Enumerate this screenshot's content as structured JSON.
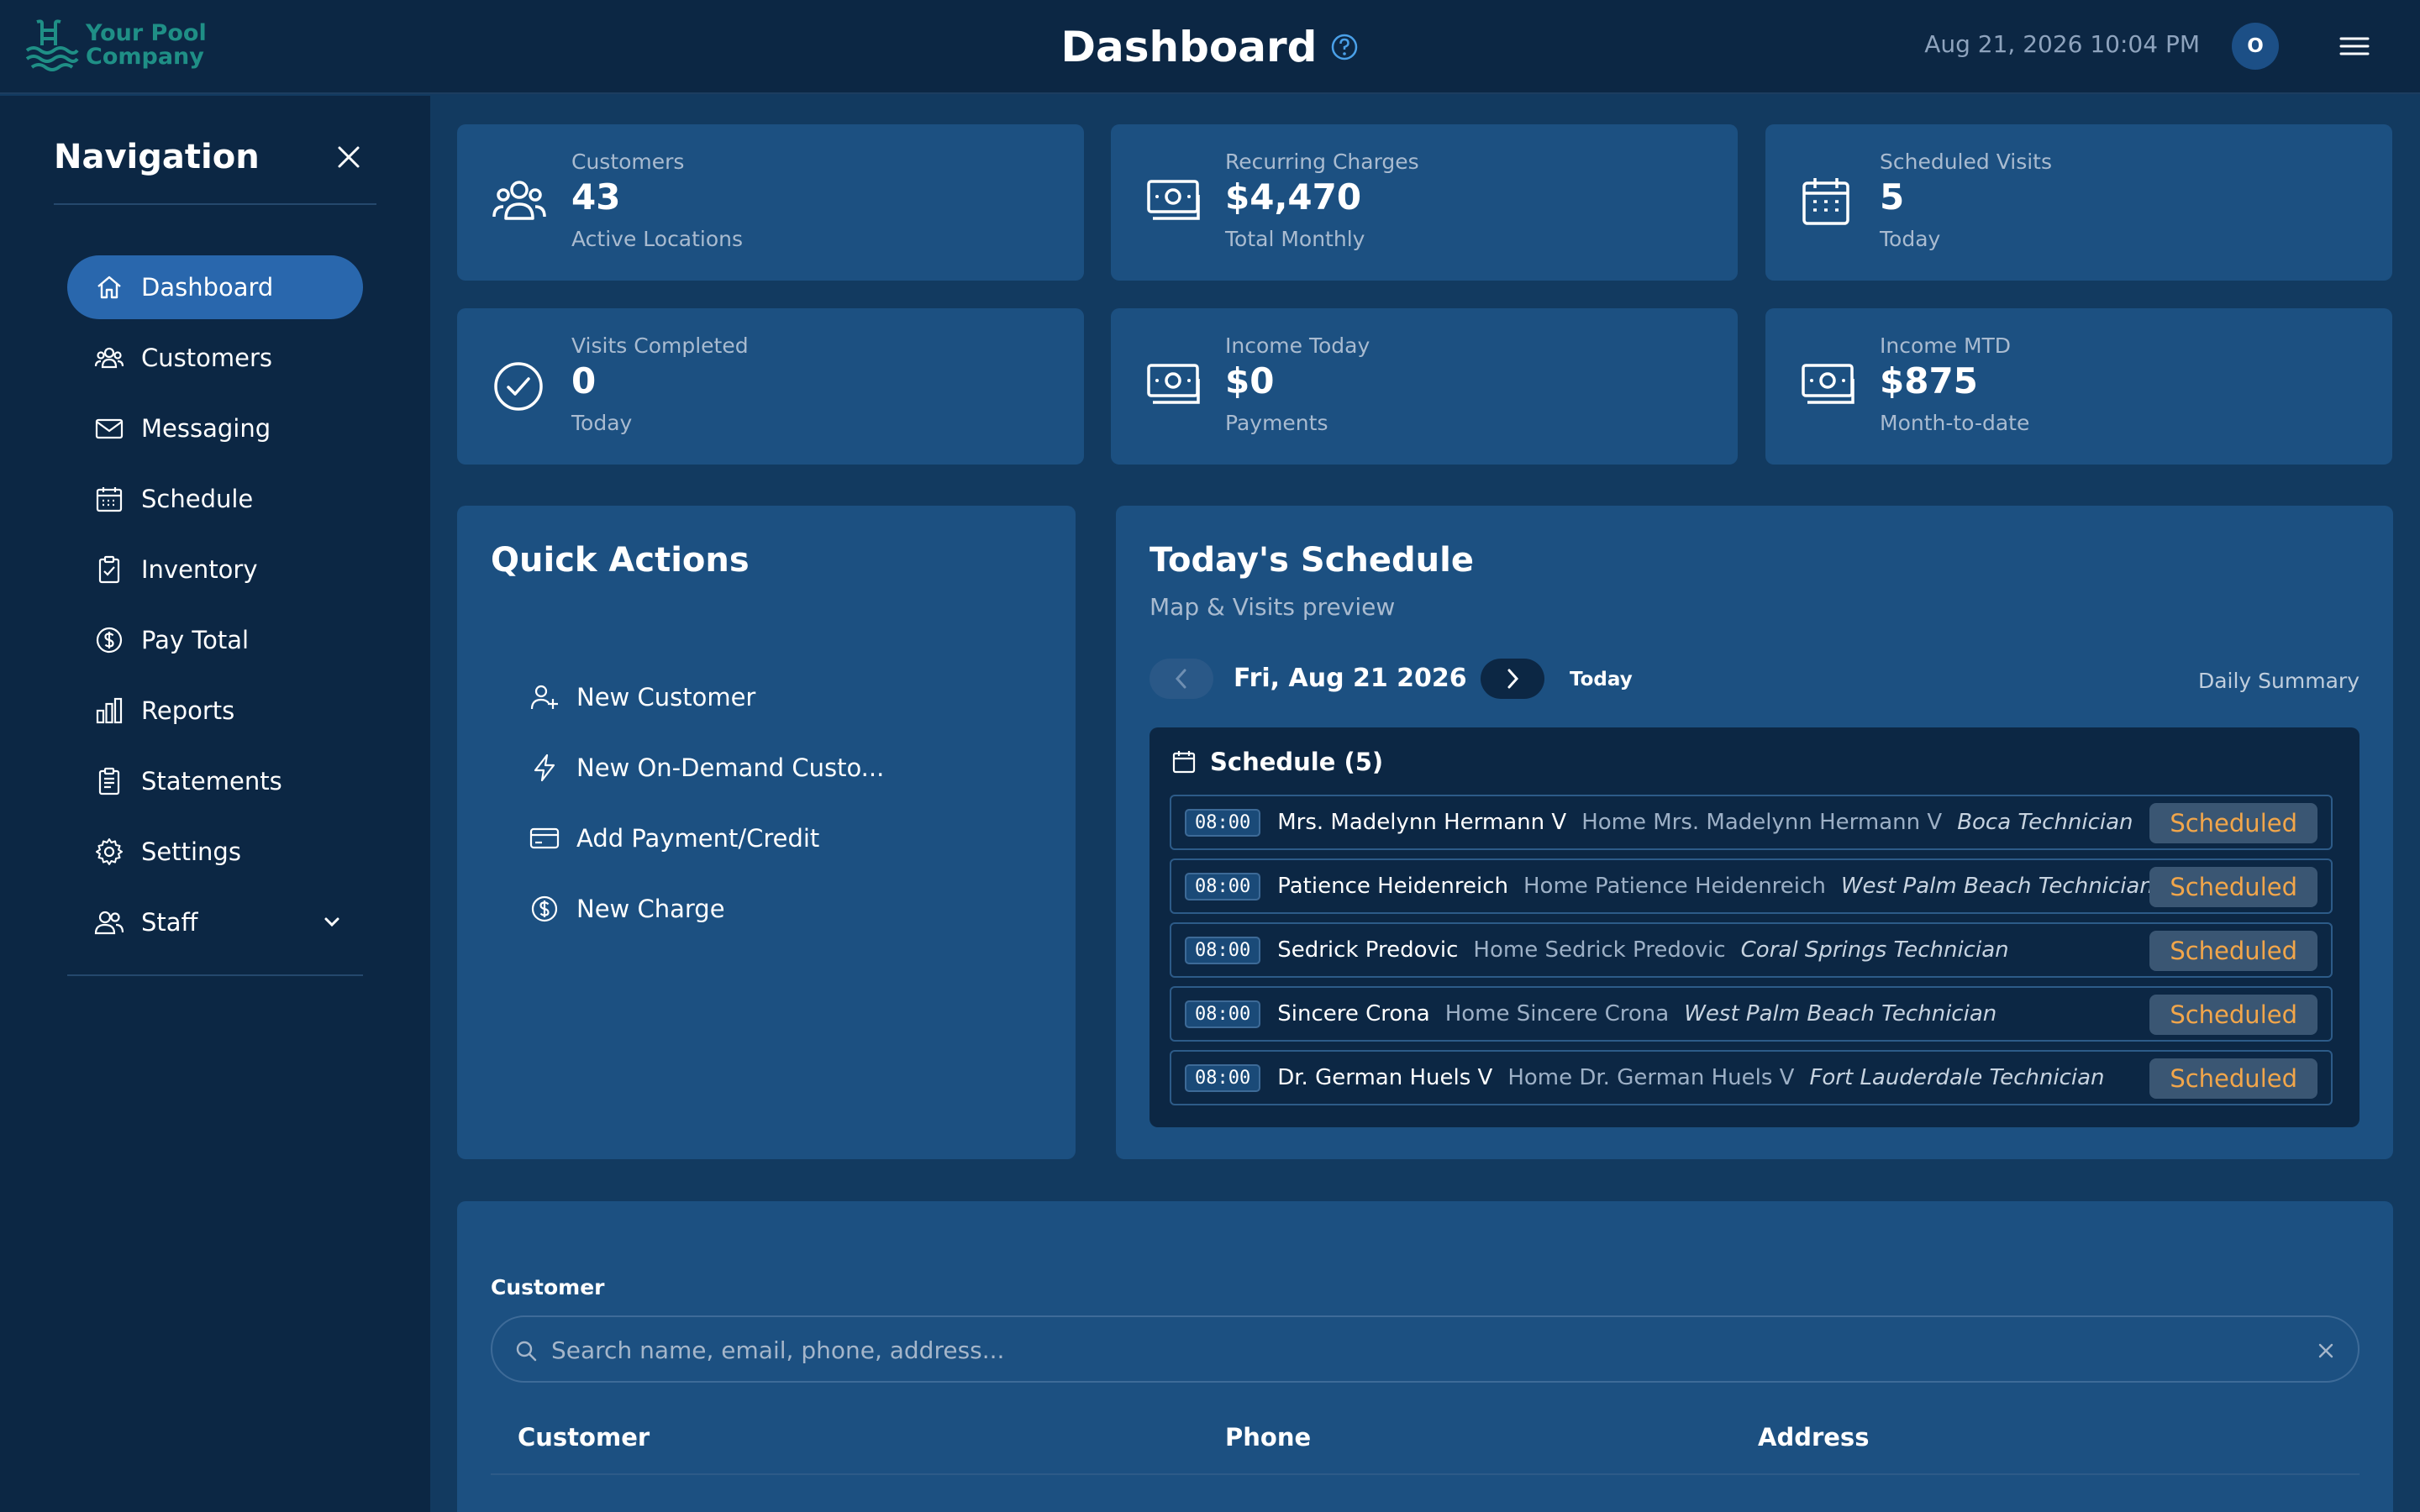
{
  "app": {
    "logo_line1": "Your Pool",
    "logo_line2": "Company",
    "page_title": "Dashboard",
    "datetime": "Aug 21, 2026 10:04 PM",
    "avatar_initial": "O",
    "colors": {
      "background": "#123a60",
      "topbar": "#0c2744",
      "card": "#1c5081",
      "accent": "#2967ad",
      "status": "#f2a64a"
    }
  },
  "sidebar": {
    "title": "Navigation",
    "items": [
      {
        "label": "Dashboard",
        "icon": "home-icon",
        "active": true
      },
      {
        "label": "Customers",
        "icon": "users-icon"
      },
      {
        "label": "Messaging",
        "icon": "mail-icon"
      },
      {
        "label": "Schedule",
        "icon": "calendar-icon"
      },
      {
        "label": "Inventory",
        "icon": "clipboard-check-icon"
      },
      {
        "label": "Pay Total",
        "icon": "dollar-circle-icon"
      },
      {
        "label": "Reports",
        "icon": "bar-chart-icon"
      },
      {
        "label": "Statements",
        "icon": "document-icon"
      },
      {
        "label": "Settings",
        "icon": "gear-icon"
      },
      {
        "label": "Staff",
        "icon": "staff-icon"
      }
    ]
  },
  "stats": [
    {
      "label": "Customers",
      "value": "43",
      "sub": "Active Locations",
      "icon": "users-icon"
    },
    {
      "label": "Recurring Charges",
      "value": "$4,470",
      "sub": "Total Monthly",
      "icon": "money-icon"
    },
    {
      "label": "Scheduled Visits",
      "value": "5",
      "sub": "Today",
      "icon": "calendar-icon"
    },
    {
      "label": "Visits Completed",
      "value": "0",
      "sub": "Today",
      "icon": "check-circle-icon"
    },
    {
      "label": "Income Today",
      "value": "$0",
      "sub": "Payments",
      "icon": "money-icon"
    },
    {
      "label": "Income MTD",
      "value": "$875",
      "sub": "Month-to-date",
      "icon": "money-icon"
    }
  ],
  "quick_actions": {
    "title": "Quick Actions",
    "items": [
      {
        "label": "New Customer",
        "icon": "user-plus-icon"
      },
      {
        "label": "New On-Demand Custo...",
        "icon": "lightning-icon"
      },
      {
        "label": "Add Payment/Credit",
        "icon": "credit-card-icon"
      },
      {
        "label": "New Charge",
        "icon": "dollar-circle-icon"
      }
    ]
  },
  "schedule": {
    "title": "Today's Schedule",
    "subtitle": "Map & Visits preview",
    "date": "Fri, Aug 21 2026",
    "today_label": "Today",
    "daily_summary": "Daily Summary",
    "box_title": "Schedule (5)",
    "rows": [
      {
        "time": "08:00",
        "name": "Mrs. Madelynn Hermann V",
        "home": "Home Mrs. Madelynn Hermann V",
        "tech": "Boca Technician",
        "status": "Scheduled"
      },
      {
        "time": "08:00",
        "name": "Patience Heidenreich",
        "home": "Home Patience Heidenreich",
        "tech": "West Palm Beach Technician",
        "status": "Scheduled"
      },
      {
        "time": "08:00",
        "name": "Sedrick Predovic",
        "home": "Home Sedrick Predovic",
        "tech": "Coral Springs Technician",
        "status": "Scheduled"
      },
      {
        "time": "08:00",
        "name": "Sincere Crona",
        "home": "Home Sincere Crona",
        "tech": "West Palm Beach Technician",
        "status": "Scheduled"
      },
      {
        "time": "08:00",
        "name": "Dr. German Huels V",
        "home": "Home Dr. German Huels V",
        "tech": "Fort Lauderdale Technician",
        "status": "Scheduled"
      }
    ]
  },
  "customer_search": {
    "label": "Customer",
    "placeholder": "Search name, email, phone, address...",
    "value": "",
    "columns": [
      "Customer",
      "Phone",
      "Address"
    ]
  }
}
